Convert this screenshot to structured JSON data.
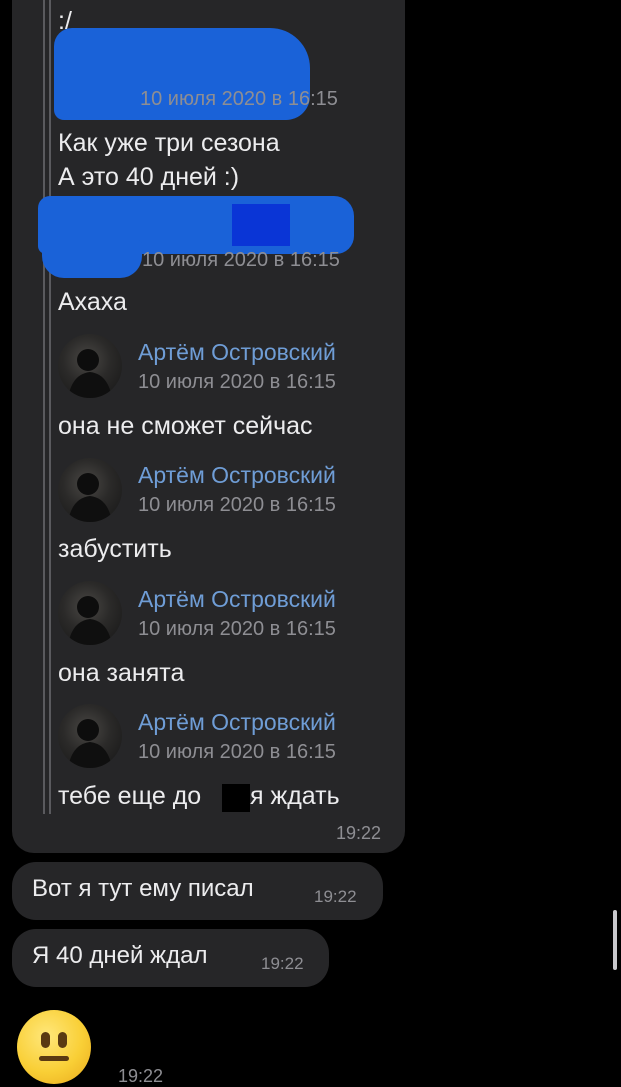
{
  "thread": {
    "top_text": ":/",
    "fwd1": {
      "date": "10 июля 2020 в 16:15",
      "lines": [
        "Как уже три сезона",
        "А это 40 дней :)"
      ]
    },
    "fwd2": {
      "date": "10 июля 2020 в 16:15",
      "text": "Ахаха"
    },
    "fwd_items": [
      {
        "author": "Артём Островский",
        "date": "10 июля 2020 в 16:15",
        "text": "она не сможет сейчас"
      },
      {
        "author": "Артём Островский",
        "date": "10 июля 2020 в 16:15",
        "text": "забустить"
      },
      {
        "author": "Артём Островский",
        "date": "10 июля 2020 в 16:15",
        "text": "она занята"
      },
      {
        "author": "Артём Островский",
        "date": "10 июля 2020 в 16:15",
        "text_before": "тебе еще до",
        "text_after": "я ждать"
      }
    ],
    "time": "19:22"
  },
  "messages": [
    {
      "text": "Вот я тут ему писал",
      "time": "19:22"
    },
    {
      "text": "Я 40 дней ждал",
      "time": "19:22"
    }
  ],
  "emoji_message": {
    "emoji_name": "neutral-face-emoji",
    "time": "19:22"
  },
  "colors": {
    "background": "#000000",
    "bubble": "#262628",
    "author": "#6f9dd6",
    "meta": "#8e8e93",
    "redaction": "#1a62d8"
  }
}
